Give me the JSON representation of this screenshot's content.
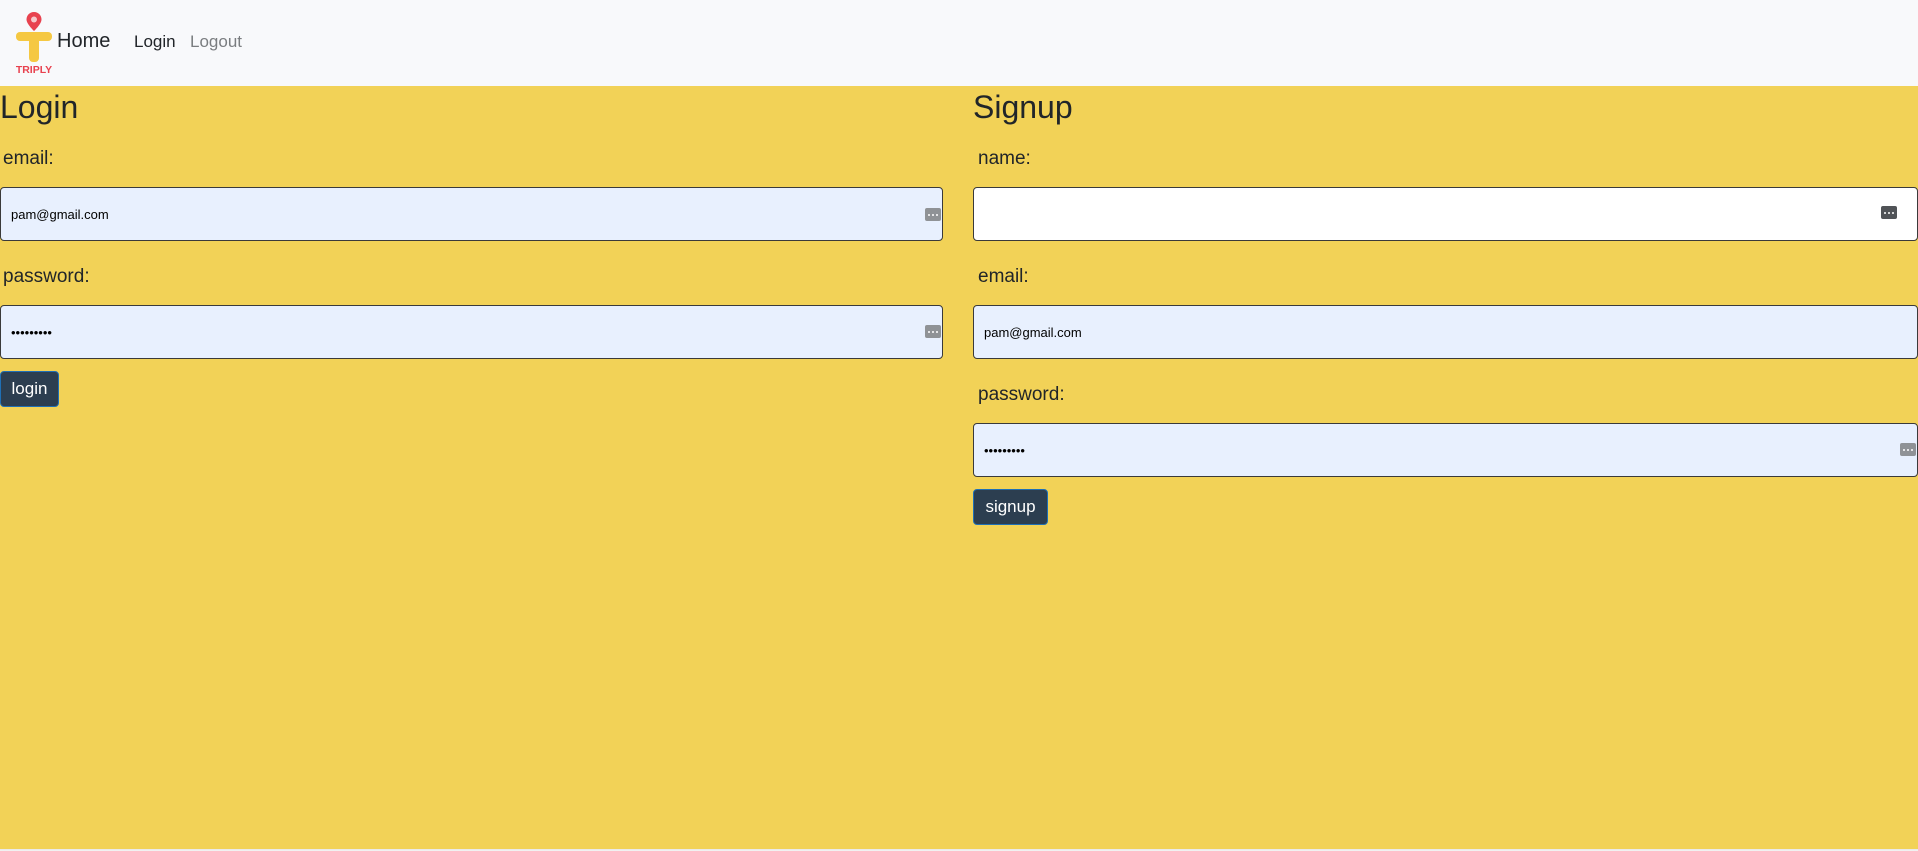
{
  "nav": {
    "brand_text": "TRIPLY",
    "home_label": "Home",
    "login_label": "Login",
    "logout_label": "Logout"
  },
  "login": {
    "title": "Login",
    "email_label": "email:",
    "email_value": "pam@gmail.com",
    "password_label": "password:",
    "password_value": "•••••••••",
    "button_label": "login"
  },
  "signup": {
    "title": "Signup",
    "name_label": "name:",
    "name_value": "",
    "email_label": "email:",
    "email_value": "pam@gmail.com",
    "password_label": "password:",
    "password_value": "•••••••••",
    "button_label": "signup"
  },
  "colors": {
    "page_background": "#f2d257",
    "navbar_background": "#f8f9fb",
    "button_background": "#2c3e50",
    "autofill_background": "#e8f0fe",
    "logo_yellow": "#f5c842",
    "logo_red": "#e8424f"
  }
}
